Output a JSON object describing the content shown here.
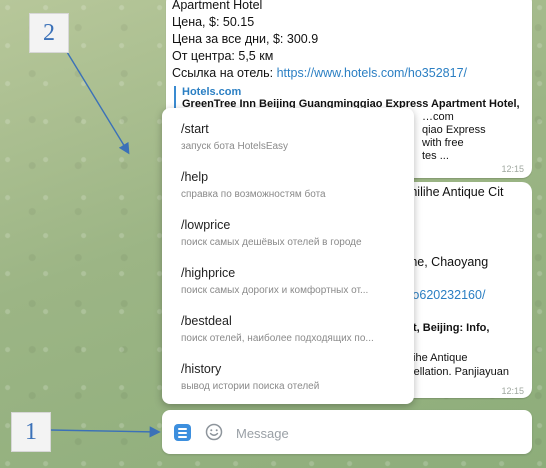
{
  "message_top": {
    "line1": "Apartment Hotel",
    "line2": "Цена, $: 50.15",
    "line3": "Цена за все дни, $: 300.9",
    "line4": "От центра: 5,5 км",
    "link_label": "Ссылка на отель: ",
    "link_url": "https://www.hotels.com/ho352817/",
    "preview_site": "Hotels.com",
    "preview_title": "GreenTree Inn Beijing Guangminggiao Express Apartment Hotel,",
    "preview_l1": "…com",
    "preview_l2": "qiao Express",
    "preview_l3": "with free",
    "preview_l4": "tes ...",
    "time": "12:15"
  },
  "message_bottom": {
    "line1": "Shilihe Antique Cit",
    "line2": "ilihe, Chaoyang",
    "line3": "/ho620232160/",
    "line4": "Cit, Beijing: Info,",
    "line5": "hilihe Antique",
    "line6": "ncellation. Panjiayuan",
    "time": "12:15"
  },
  "commands": [
    {
      "name": "/start",
      "desc": "запуск бота HotelsEasy"
    },
    {
      "name": "/help",
      "desc": "справка по возможностям бота"
    },
    {
      "name": "/lowprice",
      "desc": "поиск самых дешёвых отелей в городе"
    },
    {
      "name": "/highprice",
      "desc": "поиск самых дорогих и комфортных от..."
    },
    {
      "name": "/bestdeal",
      "desc": "поиск отелей, наиболее подходящих по..."
    },
    {
      "name": "/history",
      "desc": "вывод истории поиска отелей"
    }
  ],
  "input": {
    "placeholder": "Message",
    "value": ""
  },
  "icons": {
    "menu": "bot-menu-icon",
    "emoji": "emoji-icon"
  },
  "annotations": {
    "marker1": "1",
    "marker2": "2"
  },
  "colors": {
    "accent": "#3d8fde",
    "link": "#2b7fc3",
    "annotation": "#3b71b8"
  }
}
